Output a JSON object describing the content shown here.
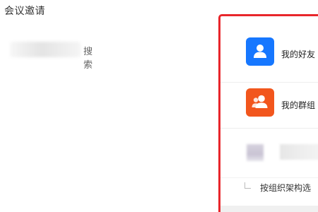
{
  "header": {
    "title": "会议邀请"
  },
  "search": {
    "label": "搜索"
  },
  "picker": {
    "items": [
      {
        "label": "我的好友",
        "icon": "user-icon",
        "color": "#1677ff"
      },
      {
        "label": "我的群组",
        "icon": "group-icon",
        "color": "#f2561d"
      }
    ],
    "org_select_label": "按组织架构选",
    "border_color": "#e8262b"
  }
}
